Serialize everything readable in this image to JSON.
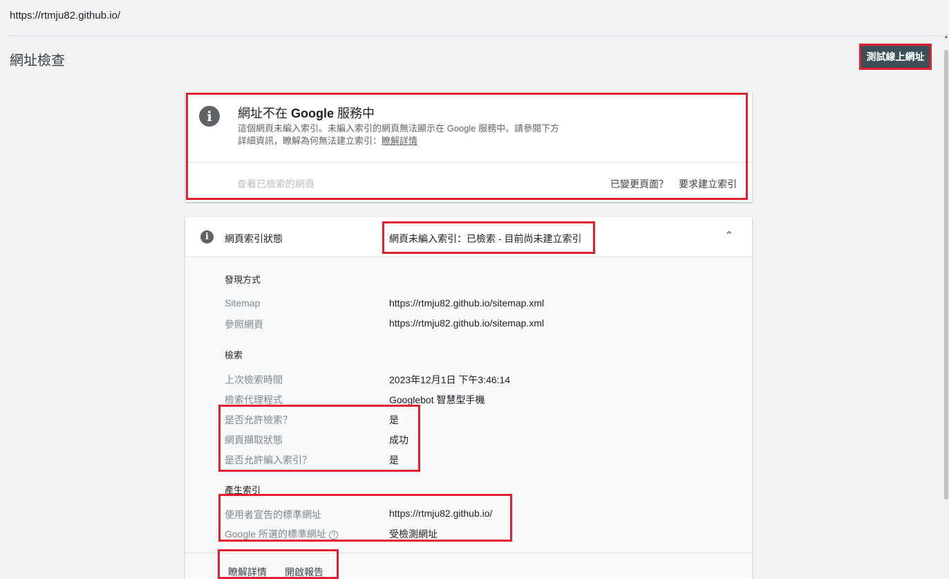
{
  "topbar": {
    "url": "https://rtmju82.github.io/"
  },
  "page": {
    "title": "網址檢查",
    "test_live_label": "測試線上網址"
  },
  "summary_card": {
    "title_prefix": "網址不在 ",
    "title_brand": "Google",
    "title_suffix": " 服務中",
    "desc_line1": "這個網頁未編入索引。未編入索引的網頁無法顯示在 Google 服務中。請參閱下方",
    "desc_line2": "詳細資訊，瞭解為何無法建立索引：",
    "learn_more": "瞭解詳情",
    "view_crawled": "查看已檢索的網頁",
    "changed_page": "已變更頁面？",
    "request_indexing": "要求建立索引"
  },
  "index_card": {
    "header_label": "網頁索引狀態",
    "header_status": "網頁未編入索引：已檢索 - 目前尚未建立索引",
    "discovery": {
      "title": "發現方式",
      "rows": [
        {
          "label": "Sitemap",
          "value": "https://rtmju82.github.io/sitemap.xml"
        },
        {
          "label": "參照網頁",
          "value": "https://rtmju82.github.io/sitemap.xml"
        }
      ]
    },
    "crawl": {
      "title": "檢索",
      "rows": [
        {
          "label": "上次檢索時間",
          "value": "2023年12月1日 下午3:46:14"
        },
        {
          "label": "檢索代理程式",
          "value": "Googlebot 智慧型手機"
        },
        {
          "label": "是否允許檢索？",
          "value": "是"
        },
        {
          "label": "網頁擷取狀態",
          "value": "成功"
        },
        {
          "label": "是否允許編入索引？",
          "value": "是"
        }
      ]
    },
    "indexing": {
      "title": "產生索引",
      "rows": [
        {
          "label": "使用者宣告的標準網址",
          "value": "https://rtmju82.github.io/"
        },
        {
          "label": "Google 所選的標準網址",
          "value": "受檢測網址"
        }
      ]
    },
    "footer": {
      "learn_more": "瞭解詳情",
      "open_report": "開啟報告"
    }
  },
  "colors": {
    "highlight": "#e0202e",
    "button_bg": "#3c4f57"
  },
  "icons": [
    "info-icon",
    "chevron-up-icon",
    "help-icon"
  ]
}
